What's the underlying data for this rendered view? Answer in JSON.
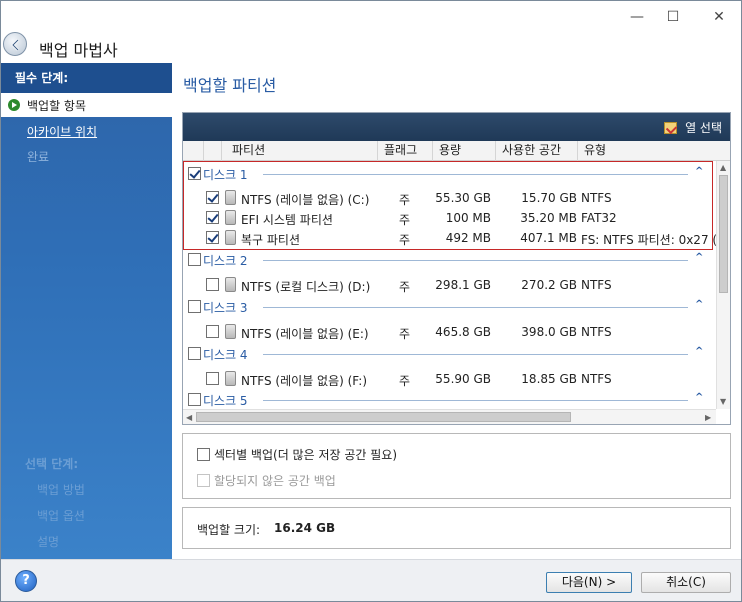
{
  "window": {
    "title": "백업 마법사",
    "controls": {
      "minimize": "—",
      "maximize": "☐",
      "close": "✕"
    }
  },
  "sidebar": {
    "required_header": "필수 단계:",
    "steps": [
      {
        "label": "백업할 항목",
        "state": "active"
      },
      {
        "label": "아카이브 위치",
        "state": "link"
      },
      {
        "label": "완료",
        "state": "disabled"
      }
    ],
    "optional_header": "선택 단계:",
    "optional_steps": [
      "백업 방법",
      "백업 옵션",
      "설명"
    ]
  },
  "main": {
    "title": "백업할 파티션",
    "column_select": "열 선택",
    "columns": [
      "파티션",
      "플래그",
      "용량",
      "사용한 공간",
      "유형"
    ],
    "disks": [
      {
        "label": "디스크 1",
        "checked": true,
        "partitions": [
          {
            "name": "NTFS (레이블 없음) (C:)",
            "flag": "주",
            "capacity": "55.30 GB",
            "used": "15.70 GB",
            "type": "NTFS",
            "checked": true
          },
          {
            "name": "EFI 시스템 파티션",
            "flag": "주",
            "capacity": "100 MB",
            "used": "35.20 MB",
            "type": "FAT32",
            "checked": true
          },
          {
            "name": "복구 파티션",
            "flag": "주",
            "capacity": "492 MB",
            "used": "407.1 MB",
            "type": "FS: NTFS 파티션: 0x27 (",
            "checked": true
          }
        ]
      },
      {
        "label": "디스크 2",
        "checked": false,
        "partitions": [
          {
            "name": "NTFS (로컬 디스크) (D:)",
            "flag": "주",
            "capacity": "298.1 GB",
            "used": "270.2 GB",
            "type": "NTFS",
            "checked": false
          }
        ]
      },
      {
        "label": "디스크 3",
        "checked": false,
        "partitions": [
          {
            "name": "NTFS (레이블 없음) (E:)",
            "flag": "주",
            "capacity": "465.8 GB",
            "used": "398.0 GB",
            "type": "NTFS",
            "checked": false
          }
        ]
      },
      {
        "label": "디스크 4",
        "checked": false,
        "partitions": [
          {
            "name": "NTFS (레이블 없음) (F:)",
            "flag": "주",
            "capacity": "55.90 GB",
            "used": "18.85 GB",
            "type": "NTFS",
            "checked": false
          }
        ]
      },
      {
        "label": "디스크 5",
        "checked": false,
        "partitions": []
      }
    ],
    "options": [
      {
        "label": "섹터별 백업(더 많은 저장 공간 필요)",
        "checked": false,
        "enabled": true
      },
      {
        "label": "할당되지 않은 공간 백업",
        "checked": false,
        "enabled": false
      }
    ],
    "backup_size_label": "백업할 크기:",
    "backup_size_value": "16.24 GB"
  },
  "footer": {
    "help_icon": "?",
    "next_label": "다음(N) >",
    "cancel_label": "취소(C)"
  },
  "colors": {
    "sidebar": "#2f6fb7",
    "accent_text": "#2a5ca4",
    "selection_border": "#c62828",
    "toolbar": "#1f3957"
  }
}
